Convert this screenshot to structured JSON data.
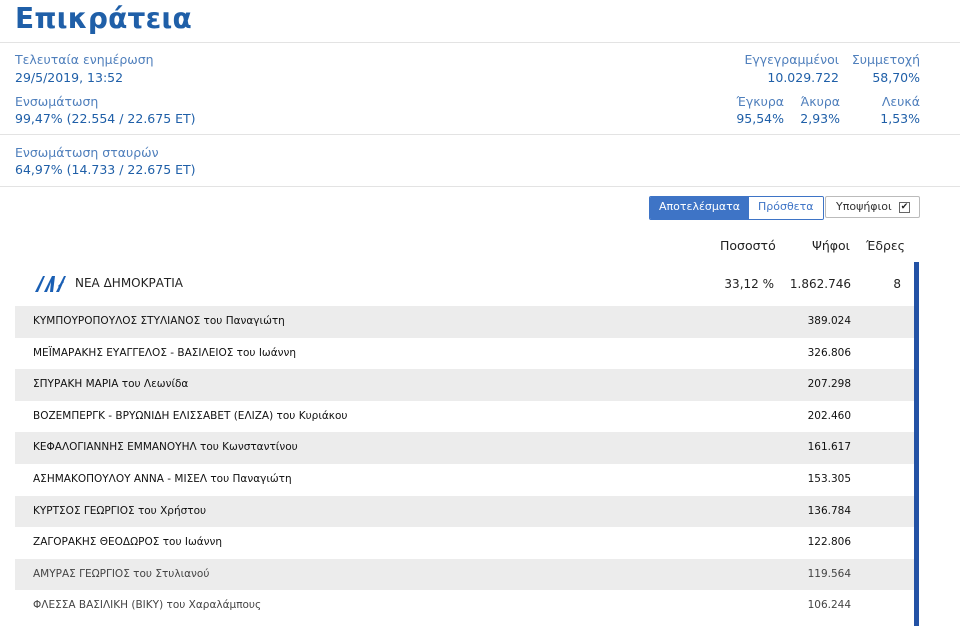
{
  "page": {
    "title": "Επικράτεια"
  },
  "stats": {
    "last_update_label": "Τελευταία ενημέρωση",
    "last_update_value": "29/5/2019, 13:52",
    "integration_label": "Ενσωμάτωση",
    "integration_value": "99,47% (22.554 / 22.675 ΕΤ)",
    "cross_integration_label": "Ενσωμάτωση σταυρών",
    "cross_integration_value": "64,97% (14.733 / 22.675 ΕΤ)",
    "registered_label": "Εγγεγραμμένοι",
    "registered_value": "10.029.722",
    "turnout_label": "Συμμετοχή",
    "turnout_value": "58,70%",
    "valid_label": "Έγκυρα",
    "valid_value": "95,54%",
    "invalid_label": "Άκυρα",
    "invalid_value": "2,93%",
    "blank_label": "Λευκά",
    "blank_value": "1,53%"
  },
  "toolbar": {
    "results_label": "Αποτελέσματα",
    "more_label": "Πρόσθετα",
    "candidates_label": "Υποψήφιοι",
    "candidates_checked": true
  },
  "table": {
    "col_percent": "Ποσοστό",
    "col_votes": "Ψήφοι",
    "col_seats": "Έδρες"
  },
  "party": {
    "name": "ΝΕΑ ΔΗΜΟΚΡΑΤΙΑ",
    "percent": "33,12 %",
    "votes": "1.862.746",
    "seats": "8",
    "logo_color": "#1a5fb4",
    "bar_color": "#2352a5"
  },
  "candidates": [
    {
      "name": "ΚΥΜΠΟΥΡΟΠΟΥΛΟΣ ΣΤΥΛΙΑΝΟΣ του Παναγιώτη",
      "votes": "389.024"
    },
    {
      "name": "ΜΕΪΜΑΡΑΚΗΣ ΕΥΑΓΓΕΛΟΣ - ΒΑΣΙΛΕΙΟΣ του Ιωάννη",
      "votes": "326.806"
    },
    {
      "name": "ΣΠΥΡΑΚΗ ΜΑΡΙΑ του Λεωνίδα",
      "votes": "207.298"
    },
    {
      "name": "ΒΟΖΕΜΠΕΡΓΚ - ΒΡΥΩΝΙΔΗ ΕΛΙΣΣΑΒΕΤ (ΕΛΙΖΑ) του Κυριάκου",
      "votes": "202.460"
    },
    {
      "name": "ΚΕΦΑΛΟΓΙΑΝΝΗΣ ΕΜΜΑΝΟΥΗΛ του Κωνσταντίνου",
      "votes": "161.617"
    },
    {
      "name": "ΑΣΗΜΑΚΟΠΟΥΛΟΥ ΑΝΝΑ - ΜΙΣΕΛ του Παναγιώτη",
      "votes": "153.305"
    },
    {
      "name": "ΚΥΡΤΣΟΣ ΓΕΩΡΓΙΟΣ του Χρήστου",
      "votes": "136.784"
    },
    {
      "name": "ΖΑΓΟΡΑΚΗΣ ΘΕΟΔΩΡΟΣ του Ιωάννη",
      "votes": "122.806"
    },
    {
      "name": "ΑΜΥΡΑΣ ΓΕΩΡΓΙΟΣ του Στυλιανού",
      "votes": "119.564"
    },
    {
      "name": "ΦΛΕΣΣΑ ΒΑΣΙΛΙΚΗ (ΒΙΚΥ) του Χαραλάμπους",
      "votes": "106.244"
    }
  ]
}
